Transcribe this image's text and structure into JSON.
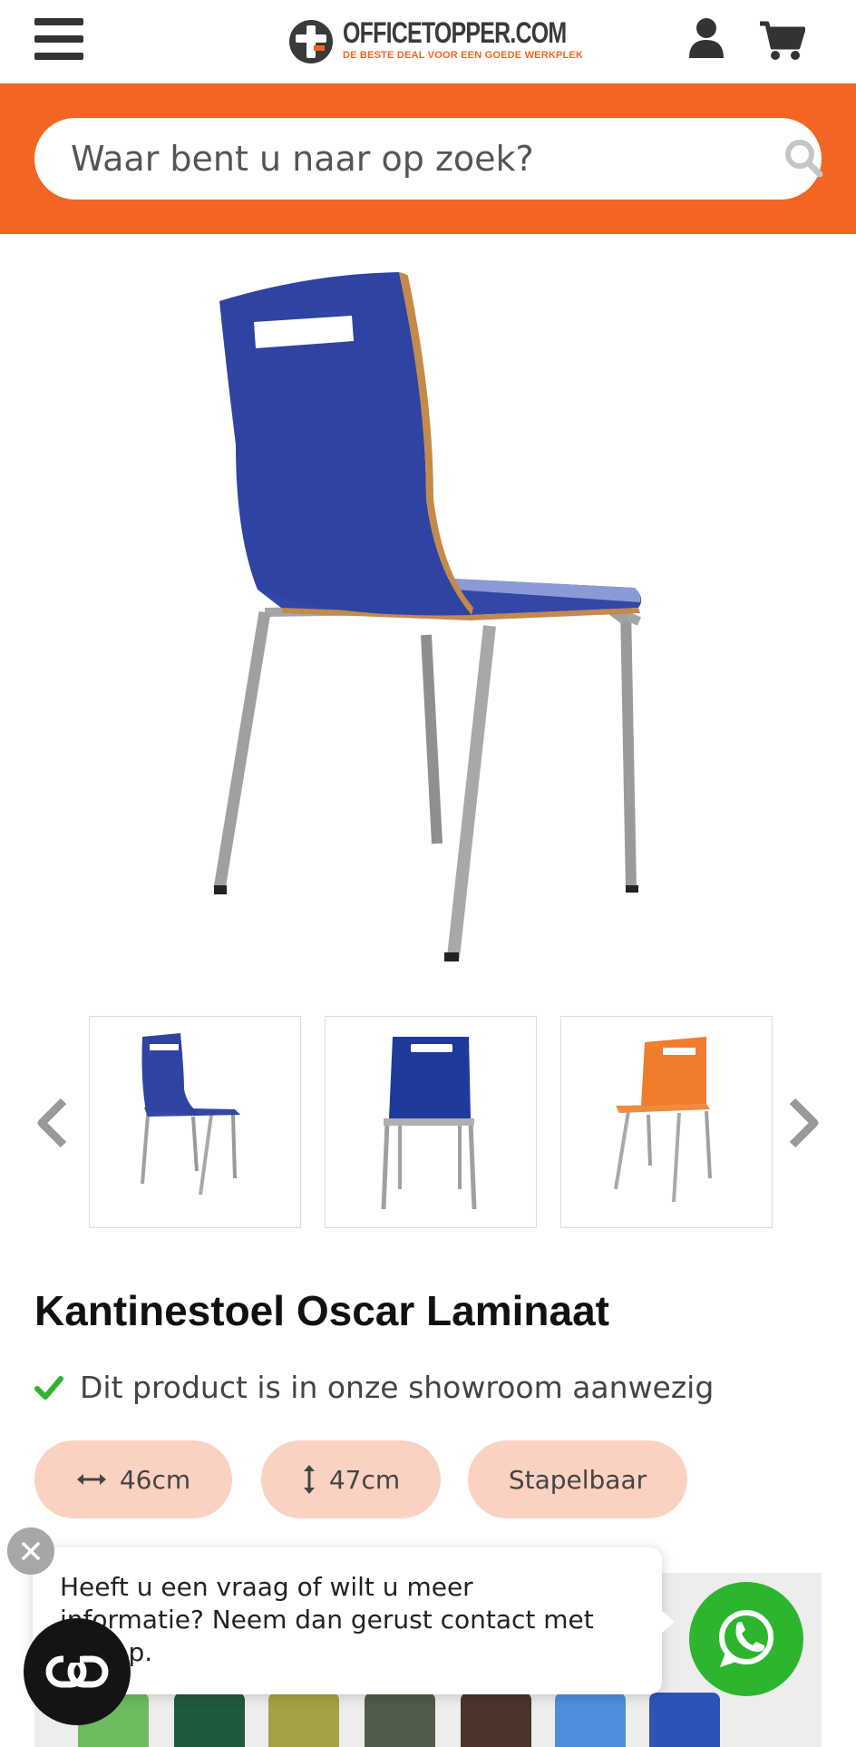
{
  "header": {
    "logo_name": "OFFICETOPPER.COM",
    "logo_tagline": "DE BESTE DEAL VOOR EEN GOEDE WERKPLEK",
    "icons": [
      "menu-icon",
      "user-icon",
      "cart-icon"
    ]
  },
  "search": {
    "placeholder": "Waar bent u naar op zoek?",
    "value": ""
  },
  "gallery": {
    "thumbnails": [
      "blue-chair-side",
      "blue-chair-front",
      "orange-chair-side"
    ]
  },
  "product": {
    "title": "Kantinestoel Oscar Laminaat",
    "showroom_text": "Dit product is in onze showroom aanwezig",
    "specs": {
      "width": "46cm",
      "height": "47cm",
      "feature": "Stapelbaar"
    }
  },
  "swatches": [
    "#6dbb5e",
    "#1f5a3c",
    "#a3a245",
    "#515b4a",
    "#4b352b",
    "#4d8fdc",
    "#2e53b8"
  ],
  "chat": {
    "message": "Heeft u een vraag of wilt u meer informatie? Neem dan gerust contact met ons op."
  },
  "colors": {
    "brand_orange": "#f26522",
    "pill_bg": "#fbd2c2",
    "whatsapp_green": "#2eb52f",
    "check_green": "#2db52d"
  }
}
